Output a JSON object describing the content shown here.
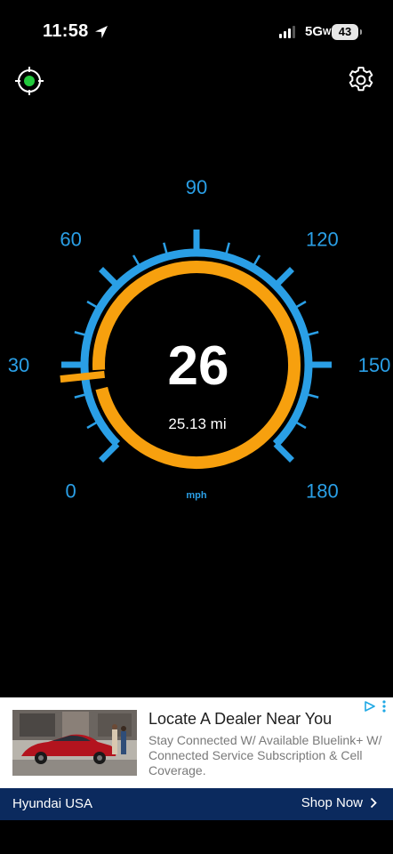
{
  "status_bar": {
    "time": "11:58",
    "network": "5G",
    "battery": "43"
  },
  "toolbar": {
    "gps_icon": "gps-target-icon",
    "settings_icon": "gear-icon"
  },
  "speedometer": {
    "speed": "26",
    "distance": "25.13 mi",
    "unit": "mph",
    "scale_labels": [
      "0",
      "30",
      "60",
      "90",
      "120",
      "150",
      "180"
    ],
    "scale_max": 180,
    "current_speed_value": 26,
    "colors": {
      "scale": "#2a9fe6",
      "needle_arc": "#f7a00e",
      "background": "#000000"
    }
  },
  "ad": {
    "title": "Locate A Dealer Near You",
    "text": "Stay Connected W/ Available Bluelink+ W/ Connected Service Subscription & Cell Coverage.",
    "advertiser": "Hyundai USA",
    "cta": "Shop Now",
    "colors": {
      "footer": "#0b2a5e",
      "ad_choices": "#1fa9e5"
    }
  }
}
